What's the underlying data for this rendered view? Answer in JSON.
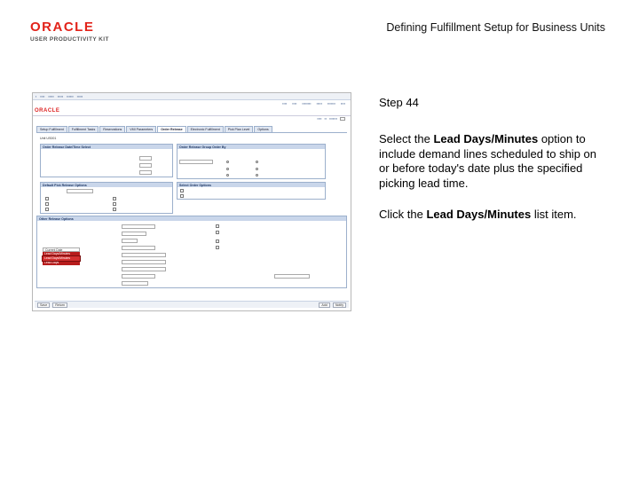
{
  "header": {
    "logo_oracle": "ORACLE",
    "logo_upk": "USER PRODUCTIVITY KIT",
    "title": "Defining Fulfillment Setup for Business Units"
  },
  "step": {
    "title": "Step 44",
    "instruction_pre": "Select the ",
    "instruction_bold": "Lead Days/Minutes",
    "instruction_post": " option to include demand lines scheduled to ship on or before today's date plus the specified picking lead time.",
    "action_pre": "Click the ",
    "action_bold": "Lead Days/Minutes",
    "action_post": " list item."
  },
  "screenshot": {
    "mini_logo": "ORACLE",
    "tabs": [
      "Setup Fulfillment",
      "Fulfillment Tasks",
      "Reservations",
      "VMI Parameters",
      "Order Release",
      "Electronic Fulfillment",
      "Pick Plan Level",
      "Options"
    ],
    "active_tab_index": 4,
    "unit_label": "Unit US001",
    "box_release_title": "Order Release Date/Time Select",
    "box_orderby_title": "Order Release Group Order By",
    "box_defaults_title": "Default Pick Release Options",
    "box_select_title": "Select Order Options",
    "box_ship_title": "Other Release Options",
    "dropdown_items": [
      "Current Date",
      "Lead Days/Minutes",
      "Lead Days/Minutes",
      "Lead Days"
    ],
    "highlighted_index": 1,
    "footer_buttons": [
      "Save",
      "Return",
      "Add",
      "Notify"
    ],
    "accent_color": "#d32f2f"
  }
}
